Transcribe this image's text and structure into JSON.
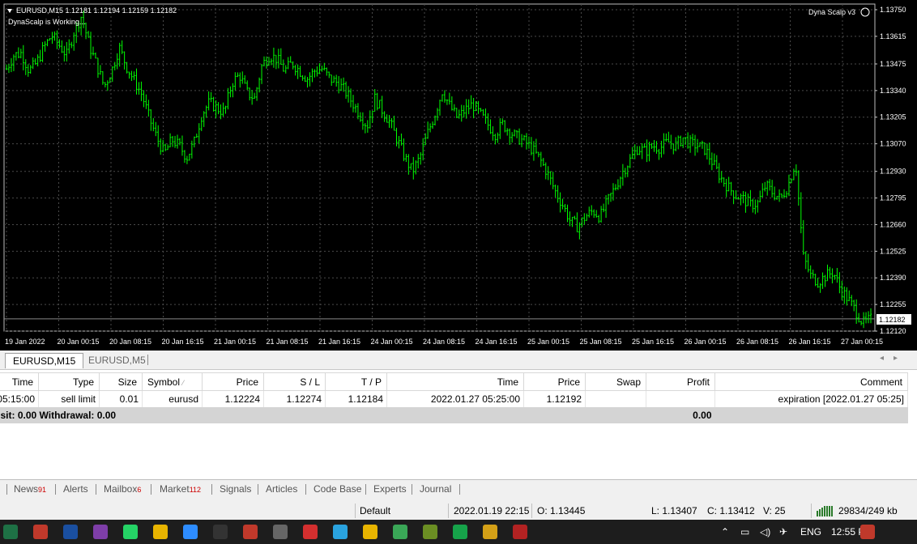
{
  "chart": {
    "symbol_line": "EURUSD,M15  1.12181 1.12194 1.12159 1.12182",
    "ea_status": "DynaScalp is Working...",
    "ea_name": "Dyna Scalp v3",
    "current_price": "1.12182",
    "colors": {
      "background": "#000000",
      "candles": "#00ff00",
      "grid": "#4a4a4a"
    }
  },
  "chart_data": {
    "type": "candlestick",
    "symbol": "EURUSD",
    "timeframe": "M15",
    "ylim": [
      1.1212,
      1.1375
    ],
    "y_ticks": [
      "1.13750",
      "1.13615",
      "1.13475",
      "1.13340",
      "1.13205",
      "1.13070",
      "1.12930",
      "1.12795",
      "1.12660",
      "1.12525",
      "1.12390",
      "1.12255",
      "1.12120"
    ],
    "x_ticks": [
      "19 Jan 2022",
      "20 Jan 00:15",
      "20 Jan 08:15",
      "20 Jan 16:15",
      "21 Jan 00:15",
      "21 Jan 08:15",
      "21 Jan 16:15",
      "24 Jan 00:15",
      "24 Jan 08:15",
      "24 Jan 16:15",
      "25 Jan 00:15",
      "25 Jan 08:15",
      "25 Jan 16:15",
      "26 Jan 00:15",
      "26 Jan 08:15",
      "26 Jan 16:15",
      "27 Jan 00:15"
    ],
    "price_path": [
      1.1345,
      1.1352,
      1.1353,
      1.1344,
      1.1348,
      1.1356,
      1.1362,
      1.1357,
      1.1352,
      1.1364,
      1.1372,
      1.1357,
      1.1347,
      1.1336,
      1.1344,
      1.1356,
      1.1346,
      1.1339,
      1.1332,
      1.132,
      1.131,
      1.1302,
      1.1309,
      1.1306,
      1.13,
      1.1308,
      1.1322,
      1.1328,
      1.1325,
      1.1323,
      1.1338,
      1.1342,
      1.1333,
      1.133,
      1.1347,
      1.1352,
      1.135,
      1.1344,
      1.1348,
      1.1344,
      1.134,
      1.1344,
      1.1345,
      1.134,
      1.1338,
      1.1334,
      1.1328,
      1.1322,
      1.1316,
      1.133,
      1.1324,
      1.1318,
      1.1309,
      1.13,
      1.1293,
      1.13,
      1.1312,
      1.1322,
      1.1334,
      1.1326,
      1.132,
      1.1324,
      1.1327,
      1.1322,
      1.1317,
      1.1312,
      1.1317,
      1.1313,
      1.131,
      1.1308,
      1.1304,
      1.1299,
      1.1292,
      1.1283,
      1.1276,
      1.1268,
      1.1265,
      1.127,
      1.1273,
      1.127,
      1.1278,
      1.1285,
      1.1293,
      1.1299,
      1.1305,
      1.1303,
      1.1306,
      1.1305,
      1.1308,
      1.1306,
      1.131,
      1.1307,
      1.1306,
      1.1304,
      1.1297,
      1.129,
      1.1285,
      1.1281,
      1.1279,
      1.1276,
      1.1277,
      1.1286,
      1.1282,
      1.1279,
      1.1286,
      1.1298,
      1.125,
      1.124,
      1.1237,
      1.124,
      1.1242,
      1.1233,
      1.1228,
      1.1222,
      1.1216,
      1.1218
    ]
  },
  "chart_tabs": [
    "EURUSD,M15",
    "EURUSD,M5"
  ],
  "orders": {
    "columns": [
      "Time",
      "Type",
      "Size",
      "Symbol",
      "Price",
      "S / L",
      "T / P",
      "Time",
      "Price",
      "Swap",
      "Profit",
      "Comment"
    ],
    "rows": [
      {
        "time": "05:15:00",
        "type": "sell limit",
        "size": "0.01",
        "symbol": "eurusd",
        "price": "1.12224",
        "sl": "1.12274",
        "tp": "1.12184",
        "time2": "2022.01.27 05:25:00",
        "price2": "1.12192",
        "swap": "",
        "profit": "",
        "comment": "expiration [2022.01.27 05:25]"
      }
    ],
    "summary": {
      "left": "sit: 0.00  Withdrawal: 0.00",
      "profit": "0.00"
    }
  },
  "bottom_tabs": [
    {
      "label": "News",
      "count": "91"
    },
    {
      "label": "Alerts",
      "count": ""
    },
    {
      "label": "Mailbox",
      "count": "6"
    },
    {
      "label": "Market",
      "count": "112"
    },
    {
      "label": "Signals",
      "count": ""
    },
    {
      "label": "Articles",
      "count": ""
    },
    {
      "label": "Code Base",
      "count": ""
    },
    {
      "label": "Experts",
      "count": ""
    },
    {
      "label": "Journal",
      "count": ""
    }
  ],
  "status": {
    "profile": "Default",
    "datetime": "2022.01.19 22:15",
    "open": "O: 1.13445",
    "low": "L: 1.13407",
    "close": "C: 1.13412",
    "volume": "V: 25",
    "traffic": "29834/249 kb"
  },
  "taskbar": {
    "lang": "ENG",
    "clock": "12:55 P",
    "icons": [
      "excel-icon",
      "app-icon",
      "photoshop-icon",
      "onenote-icon",
      "whatsapp-icon",
      "chrome-icon",
      "zoom-icon",
      "xm-icon",
      "app-icon",
      "settings-icon",
      "wps-icon",
      "telegram-icon",
      "chrome-icon",
      "edge-icon",
      "app-icon",
      "fbs-icon",
      "metatrader-icon",
      "app-icon"
    ]
  }
}
